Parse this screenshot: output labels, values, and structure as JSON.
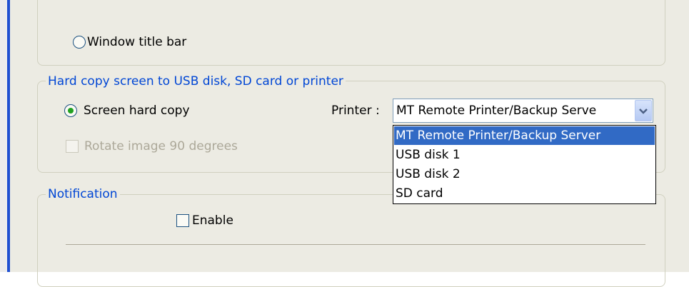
{
  "display_group": {
    "window_title_bar_label": "Window title bar"
  },
  "hard_copy_group": {
    "legend": "Hard copy screen to USB disk, SD card or printer",
    "screen_hard_copy_label": "Screen hard copy",
    "rotate_label": "Rotate image 90 degrees",
    "printer_label": "Printer :",
    "printer_value": "MT Remote Printer/Backup Serve",
    "printer_options": [
      "MT Remote Printer/Backup Server",
      "USB disk 1",
      "USB disk 2",
      "SD card"
    ],
    "selected_option_index": 0
  },
  "notification_group": {
    "legend": "Notification",
    "enable_label": "Enable"
  },
  "colors": {
    "legend_text": "#0046d5",
    "selection": "#316ac5",
    "radio_dot": "#21a121",
    "window_border": "#1f4fd1"
  },
  "icons": {
    "dropdown_arrow": "chevron-down-icon"
  }
}
